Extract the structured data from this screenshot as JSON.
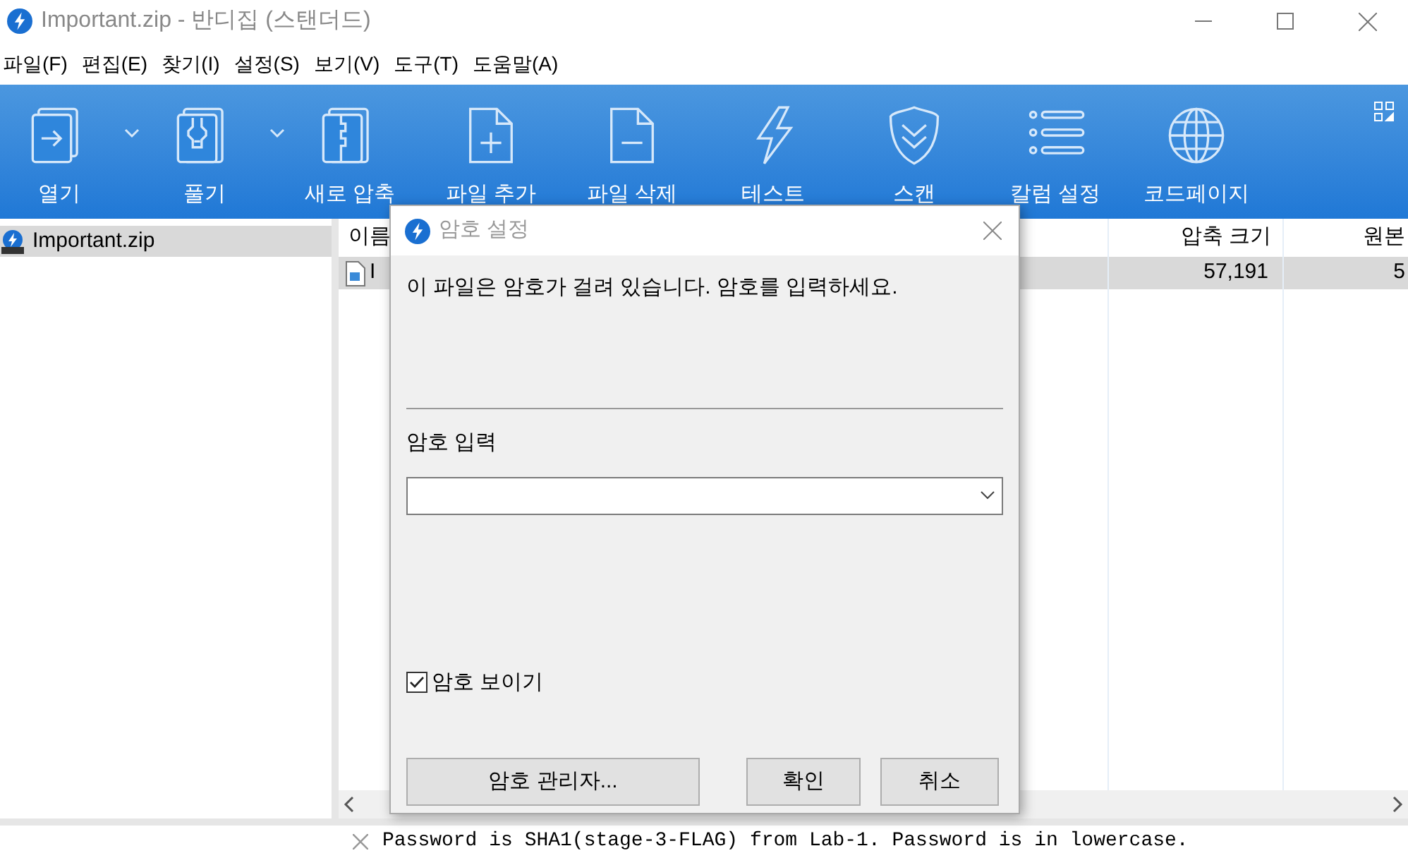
{
  "window": {
    "title": "Important.zip - 반디집 (스탠더드)"
  },
  "menu": [
    "파일(F)",
    "편집(E)",
    "찾기(I)",
    "설정(S)",
    "보기(V)",
    "도구(T)",
    "도움말(A)"
  ],
  "toolbar": [
    {
      "label": "열기",
      "kind": "open",
      "dropdown": true
    },
    {
      "label": "풀기",
      "kind": "extract",
      "dropdown": true
    },
    {
      "label": "새로 압축",
      "kind": "zip",
      "dropdown": false
    },
    {
      "label": "파일 추가",
      "kind": "add",
      "dropdown": false
    },
    {
      "label": "파일 삭제",
      "kind": "delete",
      "dropdown": false
    },
    {
      "label": "테스트",
      "kind": "test",
      "dropdown": false
    },
    {
      "label": "스캔",
      "kind": "scan",
      "dropdown": false
    },
    {
      "label": "칼럼 설정",
      "kind": "columns",
      "dropdown": false
    },
    {
      "label": "코드페이지",
      "kind": "codepage",
      "dropdown": false
    }
  ],
  "sidebar": {
    "items": [
      {
        "label": "Important.zip",
        "selected": true
      }
    ]
  },
  "table": {
    "columns": [
      "이름",
      "압축 크기",
      "원본"
    ],
    "rows": [
      {
        "cells": [
          "I",
          "57,191",
          "5"
        ],
        "selected": true
      }
    ]
  },
  "dialog": {
    "title": "암호 설정",
    "message": "이 파일은 암호가 걸려 있습니다. 암호를 입력하세요.",
    "field_label": "암호 입력",
    "show_password": {
      "label": "암호 보이기",
      "checked": true
    },
    "buttons": [
      "암호 관리자...",
      "확인",
      "취소"
    ]
  },
  "status_bar": {
    "text": "Password is SHA1(stage-3-FLAG) from Lab-1. Password is in lowercase."
  }
}
